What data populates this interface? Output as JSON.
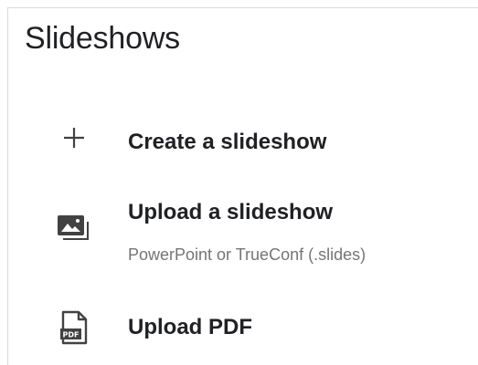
{
  "panel": {
    "title": "Slideshows"
  },
  "menu": {
    "items": [
      {
        "label": "Create a slideshow",
        "icon": "plus-icon"
      },
      {
        "label": "Upload a slideshow",
        "sublabel": "PowerPoint or TrueConf (.slides)",
        "icon": "image-stack-icon"
      },
      {
        "label": "Upload PDF",
        "icon": "pdf-file-icon",
        "icon_text": "PDF"
      }
    ]
  },
  "colors": {
    "text": "#202124",
    "secondary_text": "#757575",
    "icon": "#424242",
    "border": "#d9d9d9"
  }
}
